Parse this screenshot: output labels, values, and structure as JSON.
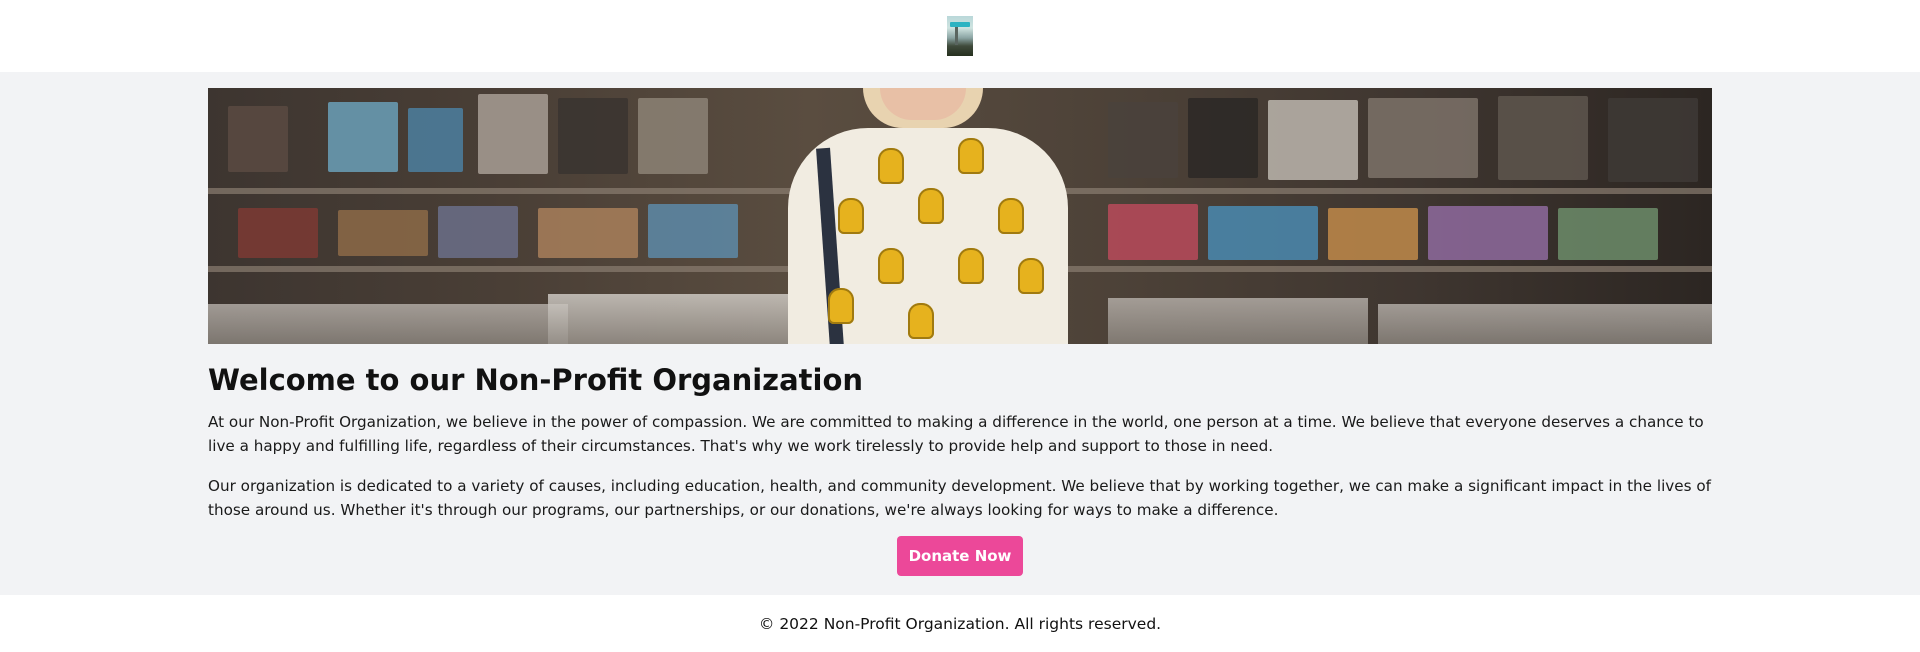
{
  "header": {
    "logo_icon": "logo-image-icon"
  },
  "hero": {
    "image_icon": "hero-photo-record-store"
  },
  "main": {
    "title": "Welcome to our Non-Profit Organization",
    "paragraphs": [
      "At our Non-Profit Organization, we believe in the power of compassion. We are committed to making a difference in the world, one person at a time. We believe that everyone deserves a chance to live a happy and fulfilling life, regardless of their circumstances. That's why we work tirelessly to provide help and support to those in need.",
      "Our organization is dedicated to a variety of causes, including education, health, and community development. We believe that by working together, we can make a significant impact in the lives of those around us. Whether it's through our programs, our partnerships, or our donations, we're always looking for ways to make a difference."
    ],
    "donate_label": "Donate Now"
  },
  "footer": {
    "copyright": "© 2022 Non-Profit Organization. All rights reserved."
  },
  "colors": {
    "accent": "#ec4899",
    "page_background": "#f2f3f5",
    "header_background": "#ffffff"
  }
}
